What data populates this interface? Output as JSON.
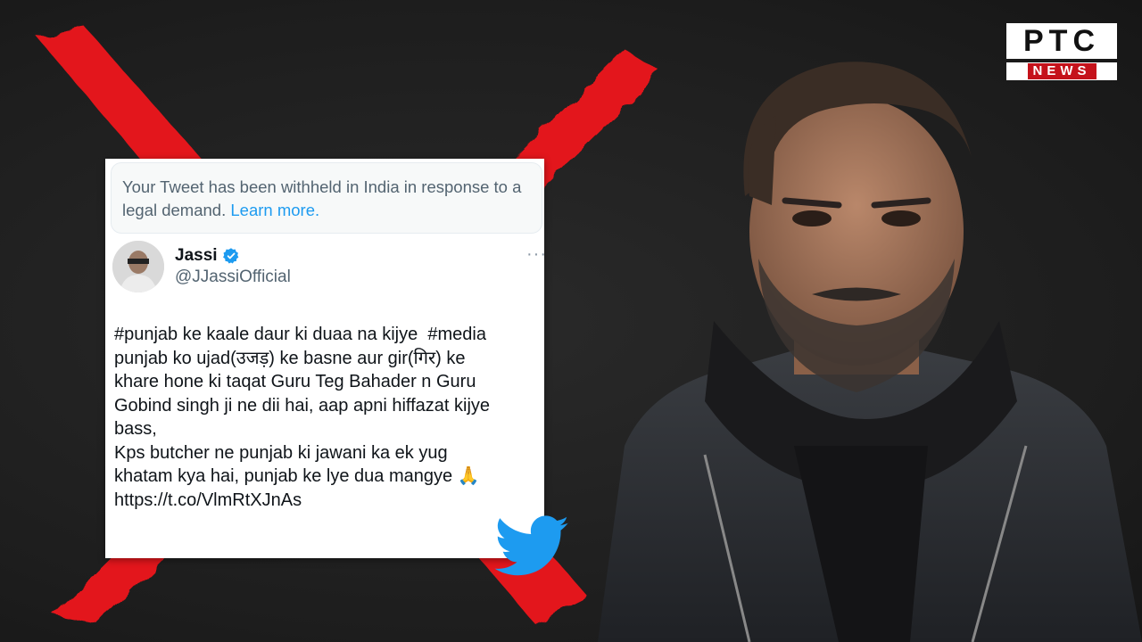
{
  "logo": {
    "brand": "PTC",
    "sub": "NEWS",
    "colors": {
      "bar": "#c5121b",
      "ground": "#ffffff"
    }
  },
  "tweet": {
    "withheld_notice": "Your Tweet has been withheld in India in response to a legal demand.",
    "learn_more": "Learn more.",
    "author_name": "Jassi",
    "author_handle": "@JJassiOfficial",
    "body_lines": [
      "#punjab ke kaale daur ki duaa na kijye  #media",
      "punjab ko ujad(उजड़) ke basne aur gir(गिर) ke",
      "khare hone ki taqat Guru Teg Bahader n Guru",
      "Gobind singh ji ne dii hai, aap apni hiffazat kijye",
      "bass,",
      "Kps butcher ne punjab ki jawani ka ek yug",
      "khatam kya hai, punjab ke lye dua mangye 🙏",
      "https://t.co/VlmRtXJnAs"
    ],
    "more_label": "···"
  },
  "icons": {
    "red_x": "cross-mark-icon",
    "verified": "verified-badge-icon",
    "twitter": "twitter-bird-icon",
    "more": "more-dots-icon"
  },
  "colors": {
    "background": "#1f1f1f",
    "red_x": "#e3151a",
    "twitter_blue": "#1d9bf0",
    "link": "#1d9bf0"
  }
}
